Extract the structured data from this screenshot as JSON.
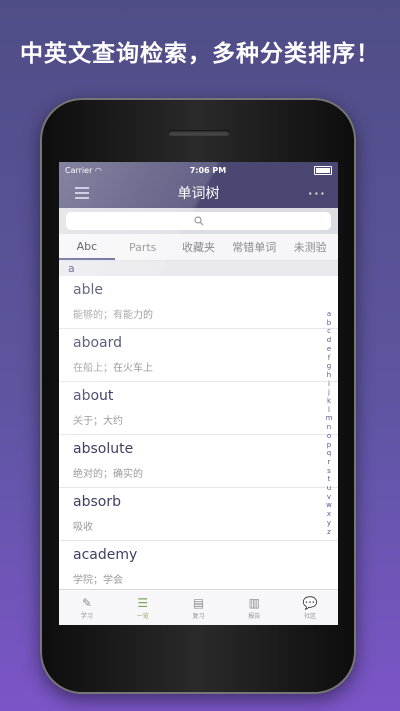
{
  "headline": "中英文查询检索，多种分类排序！",
  "status_bar": {
    "carrier": "Carrier",
    "time": "7:06 PM"
  },
  "nav": {
    "title": "单词树",
    "more": "···"
  },
  "search": {
    "icon": "search-icon"
  },
  "tabs": [
    {
      "label": "Abc",
      "active": true
    },
    {
      "label": "Parts",
      "active": false
    },
    {
      "label": "收藏夹",
      "active": false
    },
    {
      "label": "常错单词",
      "active": false
    },
    {
      "label": "未测验",
      "active": false
    }
  ],
  "section": "a",
  "words": [
    {
      "word": "able",
      "definition": "能够的；有能力的"
    },
    {
      "word": "aboard",
      "definition": "在船上；在火车上"
    },
    {
      "word": "about",
      "definition": "关于；大约"
    },
    {
      "word": "absolute",
      "definition": "绝对的；确实的"
    },
    {
      "word": "absorb",
      "definition": "吸收"
    },
    {
      "word": "academy",
      "definition": "学院；学会"
    }
  ],
  "index_letters": [
    "a",
    "b",
    "c",
    "d",
    "e",
    "f",
    "g",
    "h",
    "i",
    "j",
    "k",
    "l",
    "m",
    "n",
    "o",
    "p",
    "q",
    "r",
    "s",
    "t",
    "u",
    "v",
    "w",
    "x",
    "y",
    "z"
  ],
  "tabbar": [
    {
      "label": "学习",
      "icon": "pen-icon",
      "active": false
    },
    {
      "label": "一览",
      "icon": "list-icon",
      "active": true
    },
    {
      "label": "复习",
      "icon": "document-icon",
      "active": false
    },
    {
      "label": "报告",
      "icon": "report-icon",
      "active": false
    },
    {
      "label": "社区",
      "icon": "chat-bubble-icon",
      "active": false
    }
  ],
  "colors": {
    "nav_bg": "#4a4873",
    "accent_green": "#7fa85a",
    "background_top": "#4f4d86",
    "background_bottom": "#7b55c7"
  }
}
